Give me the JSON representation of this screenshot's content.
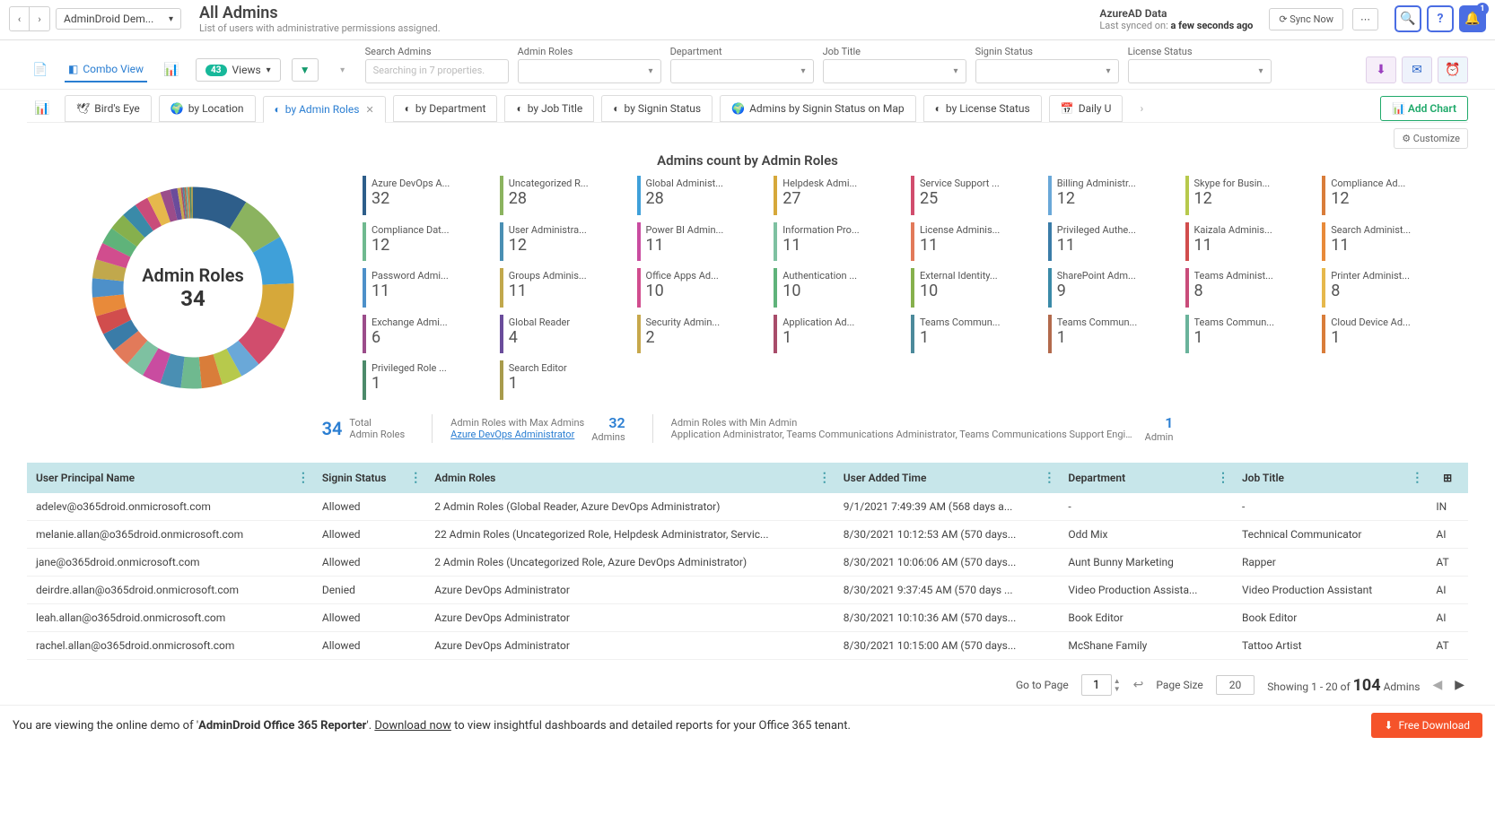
{
  "tenant": "AdminDroid Dem...",
  "page_title": "All Admins",
  "page_subtitle": "List of users with administrative permissions assigned.",
  "sync": {
    "source": "AzureAD Data",
    "label": "Last synced on: ",
    "time": "a few seconds ago",
    "btn": "⟳ Sync Now"
  },
  "views_count": "43",
  "views_label": "Views",
  "combo_label": "Combo View",
  "filters": [
    {
      "label": "Search Admins",
      "placeholder": "Searching in 7 properties.",
      "type": "input"
    },
    {
      "label": "Admin Roles",
      "type": "select"
    },
    {
      "label": "Department",
      "type": "select"
    },
    {
      "label": "Job Title",
      "type": "select"
    },
    {
      "label": "Signin Status",
      "type": "select"
    },
    {
      "label": "License Status",
      "type": "select"
    }
  ],
  "chart_tabs": [
    "Bird's Eye",
    "by Location",
    "by Admin Roles",
    "by Department",
    "by Job Title",
    "by Signin Status",
    "Admins by Signin Status on Map",
    "by License Status",
    "Daily U"
  ],
  "chart_tabs_active": 2,
  "add_chart": "Add Chart",
  "customize": "Customize",
  "chart_title": "Admins count by Admin Roles",
  "donut": {
    "label": "Admin Roles",
    "value": "34"
  },
  "chart_data": {
    "type": "pie",
    "title": "Admins count by Admin Roles",
    "series": [
      {
        "name": "Azure DevOps Administrator",
        "value": 32,
        "color": "#2e5e8a"
      },
      {
        "name": "Uncategorized Role",
        "value": 28,
        "color": "#8bb35f"
      },
      {
        "name": "Global Administrator",
        "value": 28,
        "color": "#3fa0d9"
      },
      {
        "name": "Helpdesk Administrator",
        "value": 27,
        "color": "#d6a83a"
      },
      {
        "name": "Service Support Administrator",
        "value": 25,
        "color": "#d14d6d"
      },
      {
        "name": "Billing Administrator",
        "value": 12,
        "color": "#6aa8d8"
      },
      {
        "name": "Skype for Business Administrator",
        "value": 12,
        "color": "#b7c94c"
      },
      {
        "name": "Compliance Administrator",
        "value": 12,
        "color": "#d97d3a"
      },
      {
        "name": "Compliance Data Administrator",
        "value": 12,
        "color": "#6fb98f"
      },
      {
        "name": "User Administrator",
        "value": 12,
        "color": "#4a8fb3"
      },
      {
        "name": "Power BI Administrator",
        "value": 11,
        "color": "#c94ca0"
      },
      {
        "name": "Information Protection Administrator",
        "value": 11,
        "color": "#7ec1a1"
      },
      {
        "name": "License Administrator",
        "value": 11,
        "color": "#e27a5a"
      },
      {
        "name": "Privileged Authentication Administrator",
        "value": 11,
        "color": "#3a7ca8"
      },
      {
        "name": "Kaizala Administrator",
        "value": 11,
        "color": "#d14d4d"
      },
      {
        "name": "Search Administrator",
        "value": 11,
        "color": "#e88a3a"
      },
      {
        "name": "Password Administrator",
        "value": 11,
        "color": "#4d90c9"
      },
      {
        "name": "Groups Administrator",
        "value": 11,
        "color": "#c1a84c"
      },
      {
        "name": "Office Apps Administrator",
        "value": 10,
        "color": "#d14d8e"
      },
      {
        "name": "Authentication Administrator",
        "value": 10,
        "color": "#5fb37a"
      },
      {
        "name": "External Identity Provider Administrator",
        "value": 10,
        "color": "#86b04d"
      },
      {
        "name": "SharePoint Administrator",
        "value": 9,
        "color": "#3a8aa8"
      },
      {
        "name": "Teams Administrator",
        "value": 8,
        "color": "#c94c7a"
      },
      {
        "name": "Printer Administrator",
        "value": 8,
        "color": "#e6b84c"
      },
      {
        "name": "Exchange Administrator",
        "value": 6,
        "color": "#9b4c8a"
      },
      {
        "name": "Global Reader",
        "value": 4,
        "color": "#6a4c9b"
      },
      {
        "name": "Security Administrator",
        "value": 2,
        "color": "#c7a84c"
      },
      {
        "name": "Application Administrator",
        "value": 1,
        "color": "#a84c6a"
      },
      {
        "name": "Teams Communications Administrator",
        "value": 1,
        "color": "#4c8a9b"
      },
      {
        "name": "Teams Communications Support Engineer",
        "value": 1,
        "color": "#b36a4c"
      },
      {
        "name": "Teams Communications Support Specialist",
        "value": 1,
        "color": "#6ab39b"
      },
      {
        "name": "Cloud Device Administrator",
        "value": 1,
        "color": "#d97d3a"
      },
      {
        "name": "Privileged Role Administrator",
        "value": 1,
        "color": "#4c8a6a"
      },
      {
        "name": "Search Editor",
        "value": 1,
        "color": "#a89b4c"
      }
    ]
  },
  "tiles": [
    {
      "name": "Azure DevOps A...",
      "val": "32",
      "c": "#2e5e8a"
    },
    {
      "name": "Uncategorized R...",
      "val": "28",
      "c": "#8bb35f"
    },
    {
      "name": "Global Administ...",
      "val": "28",
      "c": "#3fa0d9"
    },
    {
      "name": "Helpdesk Admi...",
      "val": "27",
      "c": "#d6a83a"
    },
    {
      "name": "Service Support ...",
      "val": "25",
      "c": "#d14d6d"
    },
    {
      "name": "Billing Administr...",
      "val": "12",
      "c": "#6aa8d8"
    },
    {
      "name": "Skype for Busin...",
      "val": "12",
      "c": "#b7c94c"
    },
    {
      "name": "Compliance Ad...",
      "val": "12",
      "c": "#d97d3a"
    },
    {
      "name": "Compliance Dat...",
      "val": "12",
      "c": "#6fb98f"
    },
    {
      "name": "User Administra...",
      "val": "12",
      "c": "#4a8fb3"
    },
    {
      "name": "Power BI Admin...",
      "val": "11",
      "c": "#c94ca0"
    },
    {
      "name": "Information Pro...",
      "val": "11",
      "c": "#7ec1a1"
    },
    {
      "name": "License Adminis...",
      "val": "11",
      "c": "#e27a5a"
    },
    {
      "name": "Privileged Authe...",
      "val": "11",
      "c": "#3a7ca8"
    },
    {
      "name": "Kaizala Adminis...",
      "val": "11",
      "c": "#d14d4d"
    },
    {
      "name": "Search Administ...",
      "val": "11",
      "c": "#e88a3a"
    },
    {
      "name": "Password Admi...",
      "val": "11",
      "c": "#4d90c9"
    },
    {
      "name": "Groups Adminis...",
      "val": "11",
      "c": "#c1a84c"
    },
    {
      "name": "Office Apps Ad...",
      "val": "10",
      "c": "#d14d8e"
    },
    {
      "name": "Authentication ...",
      "val": "10",
      "c": "#5fb37a"
    },
    {
      "name": "External Identity...",
      "val": "10",
      "c": "#86b04d"
    },
    {
      "name": "SharePoint Adm...",
      "val": "9",
      "c": "#3a8aa8"
    },
    {
      "name": "Teams Administ...",
      "val": "8",
      "c": "#c94c7a"
    },
    {
      "name": "Printer Administ...",
      "val": "8",
      "c": "#e6b84c"
    },
    {
      "name": "Exchange Admi...",
      "val": "6",
      "c": "#9b4c8a"
    },
    {
      "name": "Global Reader",
      "val": "4",
      "c": "#6a4c9b"
    },
    {
      "name": "Security Admin...",
      "val": "2",
      "c": "#c7a84c"
    },
    {
      "name": "Application Ad...",
      "val": "1",
      "c": "#a84c6a"
    },
    {
      "name": "Teams Commun...",
      "val": "1",
      "c": "#4c8a9b"
    },
    {
      "name": "Teams Commun...",
      "val": "1",
      "c": "#b36a4c"
    },
    {
      "name": "Teams Commun...",
      "val": "1",
      "c": "#6ab39b"
    },
    {
      "name": "Cloud Device Ad...",
      "val": "1",
      "c": "#d97d3a"
    },
    {
      "name": "Privileged Role ...",
      "val": "1",
      "c": "#4c8a6a"
    },
    {
      "name": "Search Editor",
      "val": "1",
      "c": "#a89b4c"
    }
  ],
  "summary": {
    "total_num": "34",
    "total_lbl1": "Total",
    "total_lbl2": "Admin Roles",
    "max_lbl": "Admin Roles with Max Admins",
    "max_link": "Azure DevOps Administrator",
    "max_num": "32",
    "max_unit": "Admins",
    "min_lbl": "Admin Roles with Min Admin",
    "min_txt": "Application Administrator, Teams Communications Administrator, Teams Communications Support Engineer, Teams Com...",
    "min_num": "1",
    "min_unit": "Admin"
  },
  "columns": [
    "User Principal Name",
    "Signin Status",
    "Admin Roles",
    "User Added Time",
    "Department",
    "Job Title",
    ""
  ],
  "rows": [
    [
      "adelev@o365droid.onmicrosoft.com",
      "Allowed",
      "2 Admin Roles (Global Reader, Azure DevOps Administrator)",
      "9/1/2021 7:49:39 AM (568 days a...",
      "-",
      "-",
      "IN"
    ],
    [
      "melanie.allan@o365droid.onmicrosoft.com",
      "Allowed",
      "22 Admin Roles (Uncategorized Role, Helpdesk Administrator, Servic...",
      "8/30/2021 10:12:53 AM (570 days...",
      "Odd Mix",
      "Technical Communicator",
      "AI"
    ],
    [
      "jane@o365droid.onmicrosoft.com",
      "Allowed",
      "2 Admin Roles (Uncategorized Role, Azure DevOps Administrator)",
      "8/30/2021 10:06:06 AM (570 days...",
      "Aunt Bunny Marketing",
      "Rapper",
      "AT"
    ],
    [
      "deirdre.allan@o365droid.onmicrosoft.com",
      "Denied",
      "Azure DevOps Administrator",
      "8/30/2021 9:37:45 AM (570 days ...",
      "Video Production Assista...",
      "Video Production Assistant",
      "AI"
    ],
    [
      "leah.allan@o365droid.onmicrosoft.com",
      "Allowed",
      "Azure DevOps Administrator",
      "8/30/2021 10:10:36 AM (570 days...",
      "Book Editor",
      "Book Editor",
      "AI"
    ],
    [
      "rachel.allan@o365droid.onmicrosoft.com",
      "Allowed",
      "Azure DevOps Administrator",
      "8/30/2021 10:15:00 AM (570 days...",
      "McShane Family",
      "Tattoo Artist",
      "AT"
    ]
  ],
  "pager": {
    "goto": "Go to Page",
    "page": "1",
    "pgsize_lbl": "Page Size",
    "pgsize": "20",
    "showing": "Showing 1 - 20 of",
    "total": "104",
    "unit": "Admins"
  },
  "demo": {
    "pre": "You are viewing the online demo of '",
    "name": "AdminDroid Office 365 Reporter",
    "mid": "'. ",
    "link": "Download now",
    "post": " to view insightful dashboards and detailed reports for your Office 365 tenant.",
    "btn": "Free Download"
  }
}
